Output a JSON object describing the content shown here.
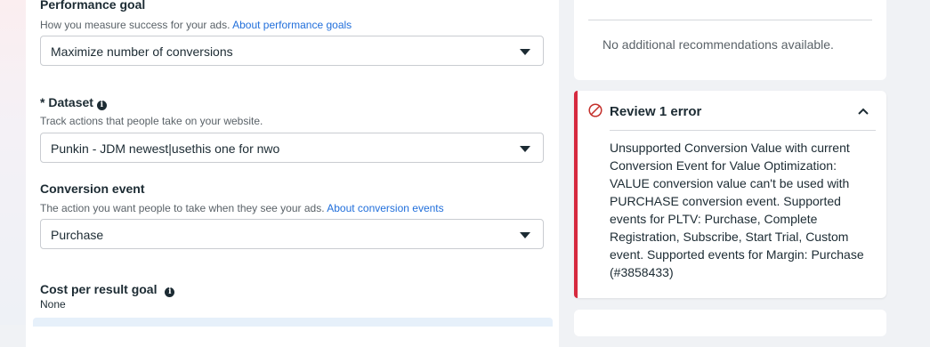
{
  "performance_goal": {
    "title": "Performance goal",
    "description": "How you measure success for your ads.",
    "link": "About performance goals",
    "selected": "Maximize number of conversions"
  },
  "dataset": {
    "required_mark": "*",
    "title": "Dataset",
    "description": "Track actions that people take on your website.",
    "selected": "Punkin - JDM newest|usethis one for nwo"
  },
  "conversion_event": {
    "title": "Conversion event",
    "description": "The action you want people to take when they see your ads.",
    "link": "About conversion events",
    "selected": "Purchase"
  },
  "cost_per_result_goal": {
    "title": "Cost per result goal",
    "value": "None"
  },
  "recommendations": {
    "text": "No additional recommendations available."
  },
  "review": {
    "title": "Review 1 error",
    "message": "Unsupported Conversion Value with current Conversion Event for Value Optimization: VALUE conversion value can't be used with PURCHASE conversion event. Supported events for PLTV: Purchase, Complete Registration, Subscribe, Start Trial, Custom event. Supported events for Margin: Purchase (#3858433)"
  },
  "icons": {
    "info": "info-icon",
    "caret": "caret-down-icon",
    "error": "prohibited-icon",
    "collapse": "chevron-up-icon"
  },
  "colors": {
    "link": "#216fdb",
    "error_bar": "#d6293e",
    "error_icon": "#c4302b"
  }
}
